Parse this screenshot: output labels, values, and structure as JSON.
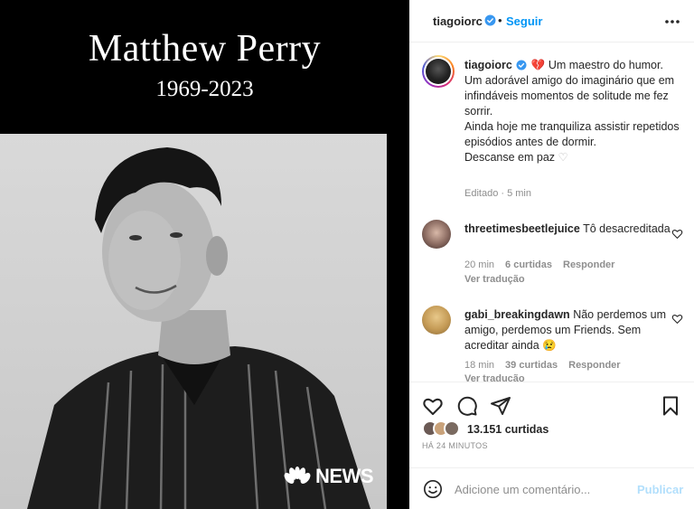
{
  "media": {
    "title": "Matthew Perry",
    "years": "1969-2023",
    "logo_text": "NEWS"
  },
  "header": {
    "username": "tiagoiorc",
    "separator": "•",
    "follow_label": "Seguir"
  },
  "caption": {
    "username": "tiagoiorc",
    "lines": [
      "Um maestro do humor.",
      "Um adorável amigo do imaginário que em infindáveis momentos de solitude me fez sorrir.",
      "Ainda hoje me tranquiliza assistir repetidos episódios antes de dormir.",
      "Descanse em paz"
    ],
    "meta": "Editado · 5 min"
  },
  "comments": [
    {
      "username": "threetimesbeetlejuice",
      "text": "Tô desacreditada",
      "time": "20 min",
      "likes": "6 curtidas",
      "reply": "Responder",
      "translate": "Ver tradução"
    },
    {
      "username": "gabi_breakingdawn",
      "text": "Não perdemos um amigo, perdemos um Friends. Sem acreditar ainda",
      "time": "18 min",
      "likes": "39 curtidas",
      "reply": "Responder",
      "translate": "Ver tradução"
    }
  ],
  "footer": {
    "likes_count": "13.151 curtidas",
    "time_ago": "HÁ 24 MINUTOS",
    "comment_placeholder": "Adicione um comentário...",
    "publish_label": "Publicar"
  },
  "colors": {
    "accent": "#0095f6",
    "publish_disabled": "#b2dffc",
    "heart": "#e0245e",
    "verified": "#3897f0"
  },
  "icons": [
    "more-icon",
    "verified-icon",
    "heart-icon",
    "comment-icon",
    "share-icon",
    "bookmark-icon",
    "emoji-icon"
  ]
}
